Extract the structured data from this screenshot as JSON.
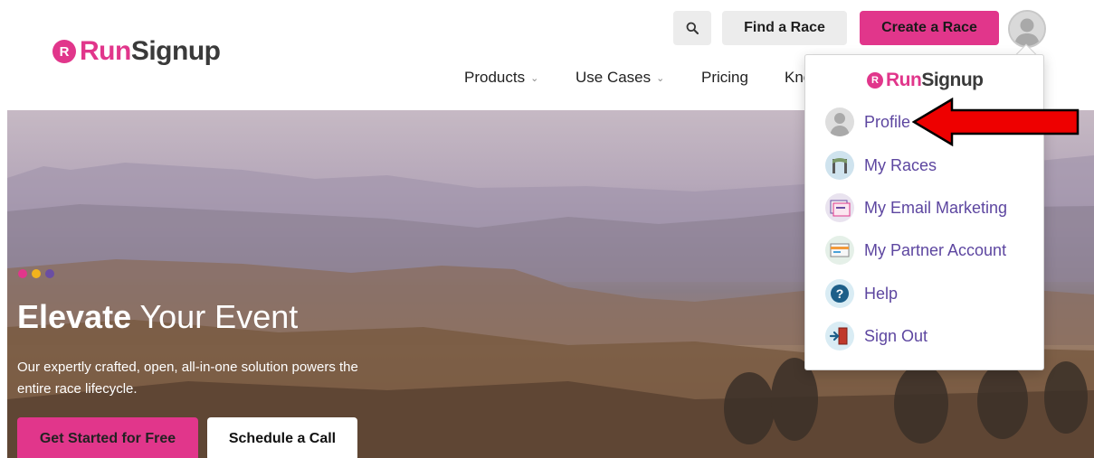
{
  "header": {
    "logo": {
      "mark": "R",
      "run": "Run",
      "signup": "Signup"
    },
    "search_icon": "search-icon",
    "find_race_label": "Find a Race",
    "create_race_label": "Create a Race",
    "avatar_icon": "user-avatar-icon"
  },
  "nav": {
    "products": "Products",
    "use_cases": "Use Cases",
    "pricing": "Pricing",
    "knowledge": "Kno"
  },
  "hero": {
    "title_bold": "Elevate",
    "title_rest": " Your Event",
    "subtitle": "Our expertly crafted, open, all-in-one solution powers the entire race lifecycle.",
    "cta_primary": "Get Started for Free",
    "cta_secondary": "Schedule a Call",
    "dot_colors": [
      "#e1368b",
      "#f2b31d",
      "#6a4ea3"
    ]
  },
  "dropdown": {
    "logo": {
      "mark": "R",
      "run": "Run",
      "signup": "Signup"
    },
    "items": [
      {
        "label": "Profile",
        "icon": "profile-icon"
      },
      {
        "label": "My Races",
        "icon": "races-icon"
      },
      {
        "label": "My Email Marketing",
        "icon": "email-marketing-icon"
      },
      {
        "label": "My Partner Account",
        "icon": "partner-account-icon"
      },
      {
        "label": "Help",
        "icon": "help-icon"
      },
      {
        "label": "Sign Out",
        "icon": "sign-out-icon"
      }
    ]
  },
  "colors": {
    "brand_pink": "#e1368b",
    "menu_purple": "#5d46a0",
    "annotation_red": "#ee0000"
  }
}
